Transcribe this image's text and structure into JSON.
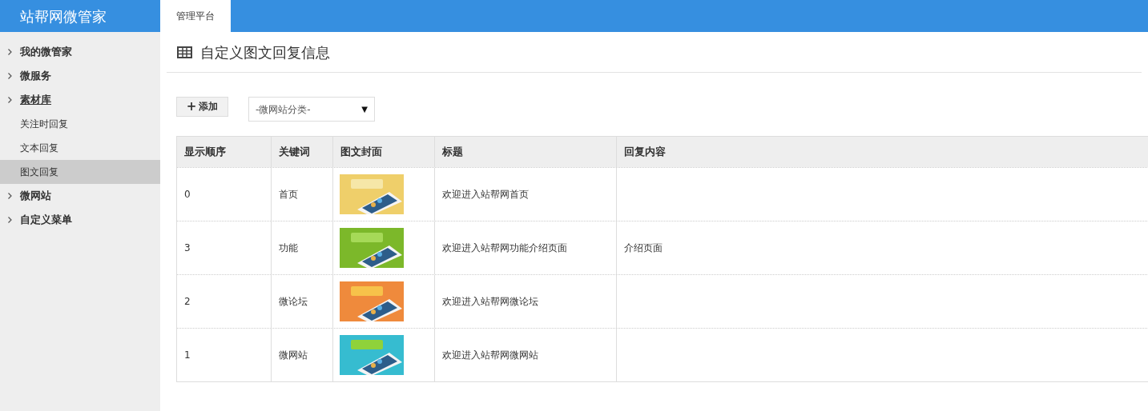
{
  "app": {
    "title": "站帮网微管家"
  },
  "tabs": [
    {
      "label": "管理平台",
      "selected": true
    }
  ],
  "sidebar": {
    "items": [
      {
        "label": "我的微管家",
        "expanded": false
      },
      {
        "label": "微服务",
        "expanded": false
      },
      {
        "label": "素材库",
        "expanded": true,
        "children": [
          {
            "label": "关注时回复",
            "selected": false
          },
          {
            "label": "文本回复",
            "selected": false
          },
          {
            "label": "图文回复",
            "selected": true
          }
        ]
      },
      {
        "label": "微网站",
        "expanded": false
      },
      {
        "label": "自定义菜单",
        "expanded": false
      }
    ]
  },
  "page": {
    "title": "自定义图文回复信息"
  },
  "toolbar": {
    "add_button": {
      "icon": "+",
      "label": "添加"
    },
    "category_select": {
      "value": "-微网站分类-",
      "arrow": "▼"
    }
  },
  "table": {
    "columns": [
      "显示顺序",
      "关键词",
      "图文封面",
      "标题",
      "回复内容"
    ],
    "rows": [
      {
        "order": "0",
        "keyword": "首页",
        "title": "欢迎进入站帮网首页",
        "reply": ""
      },
      {
        "order": "3",
        "keyword": "功能",
        "title": "欢迎进入站帮网功能介绍页面",
        "reply": "介绍页面"
      },
      {
        "order": "2",
        "keyword": "微论坛",
        "title": "欢迎进入站帮网微论坛",
        "reply": ""
      },
      {
        "order": "1",
        "keyword": "微网站",
        "title": "欢迎进入站帮网微网站",
        "reply": ""
      }
    ]
  }
}
